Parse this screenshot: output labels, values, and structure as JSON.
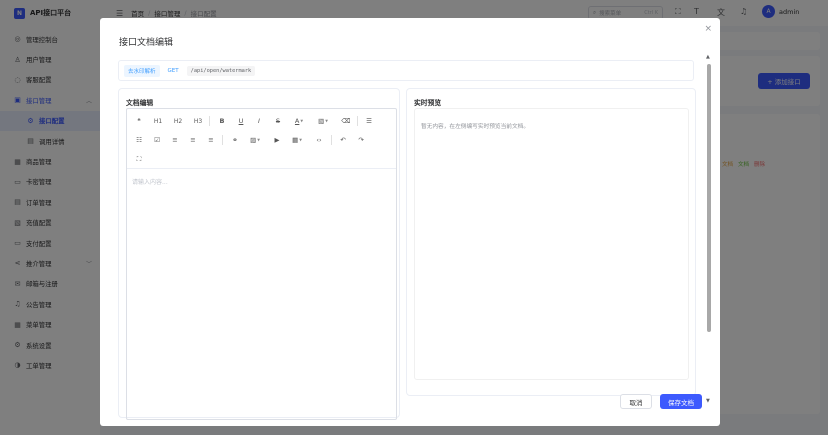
{
  "app": {
    "title": "API接口平台",
    "logo_letter": "N"
  },
  "sidebar": {
    "items": [
      {
        "icon": "dashboard-icon",
        "glyph": "◎",
        "label": "管理控制台"
      },
      {
        "icon": "user-icon",
        "glyph": "♙",
        "label": "用户管理"
      },
      {
        "icon": "chat-icon",
        "glyph": "◌",
        "label": "客服配置"
      },
      {
        "icon": "api-icon",
        "glyph": "▣",
        "label": "接口管理"
      },
      {
        "icon": "gear-icon",
        "glyph": "⚙",
        "label": "接口配置"
      },
      {
        "icon": "doc-icon",
        "glyph": "▤",
        "label": "调用详情"
      },
      {
        "icon": "shop-icon",
        "glyph": "▦",
        "label": "商品管理"
      },
      {
        "icon": "card-icon",
        "glyph": "▭",
        "label": "卡密管理"
      },
      {
        "icon": "order-icon",
        "glyph": "▤",
        "label": "订单管理"
      },
      {
        "icon": "recharge-icon",
        "glyph": "▧",
        "label": "充值配置"
      },
      {
        "icon": "wallet-icon",
        "glyph": "▭",
        "label": "支付配置"
      },
      {
        "icon": "share-icon",
        "glyph": "⋖",
        "label": "推介管理"
      },
      {
        "icon": "mail-icon",
        "glyph": "✉",
        "label": "邮箱与注册"
      },
      {
        "icon": "bell-icon",
        "glyph": "♫",
        "label": "公告管理"
      },
      {
        "icon": "menu-grid-icon",
        "glyph": "▦",
        "label": "菜单管理"
      },
      {
        "icon": "settings-icon",
        "glyph": "⚙",
        "label": "系统设置"
      },
      {
        "icon": "headset-icon",
        "glyph": "◑",
        "label": "工单管理"
      }
    ]
  },
  "header": {
    "breadcrumbs": [
      "首页",
      "接口管理",
      "接口配置"
    ],
    "search_placeholder": "搜索菜单",
    "search_shortcut": "Ctrl K",
    "username": "admin",
    "avatar_letter": "A"
  },
  "page": {
    "add_button": "+ 添加接口",
    "row_actions": [
      "文档",
      "文档",
      "删除"
    ]
  },
  "modal": {
    "title": "接口文档编辑",
    "close_glyph": "×",
    "api_name": "去水印解析",
    "api_method": "GET",
    "api_path": "/api/open/watermark",
    "editor_title": "文档编辑",
    "editor_placeholder": "请输入内容...",
    "preview_title": "实时预览",
    "preview_empty": "暂无内容，在左侧编写实时预览当前文档。",
    "cancel_label": "取消",
    "save_label": "保存文档"
  },
  "toolbar": {
    "quote": "❝",
    "h1": "H1",
    "h2": "H2",
    "h3": "H3",
    "bold": "B",
    "underline": "U",
    "italic": "I",
    "strike": "S",
    "font_color": "A",
    "bg_color": "▧",
    "clear": "⌫",
    "bullet": "☰",
    "ordered": "☷",
    "todo": "☑",
    "align_left": "≡",
    "align_center": "≡",
    "align_right": "≡",
    "link": "⚭",
    "image": "▨",
    "video": "▶",
    "table": "▦",
    "code": "‹›",
    "undo": "↶",
    "redo": "↷",
    "fullscreen": "⛶"
  }
}
